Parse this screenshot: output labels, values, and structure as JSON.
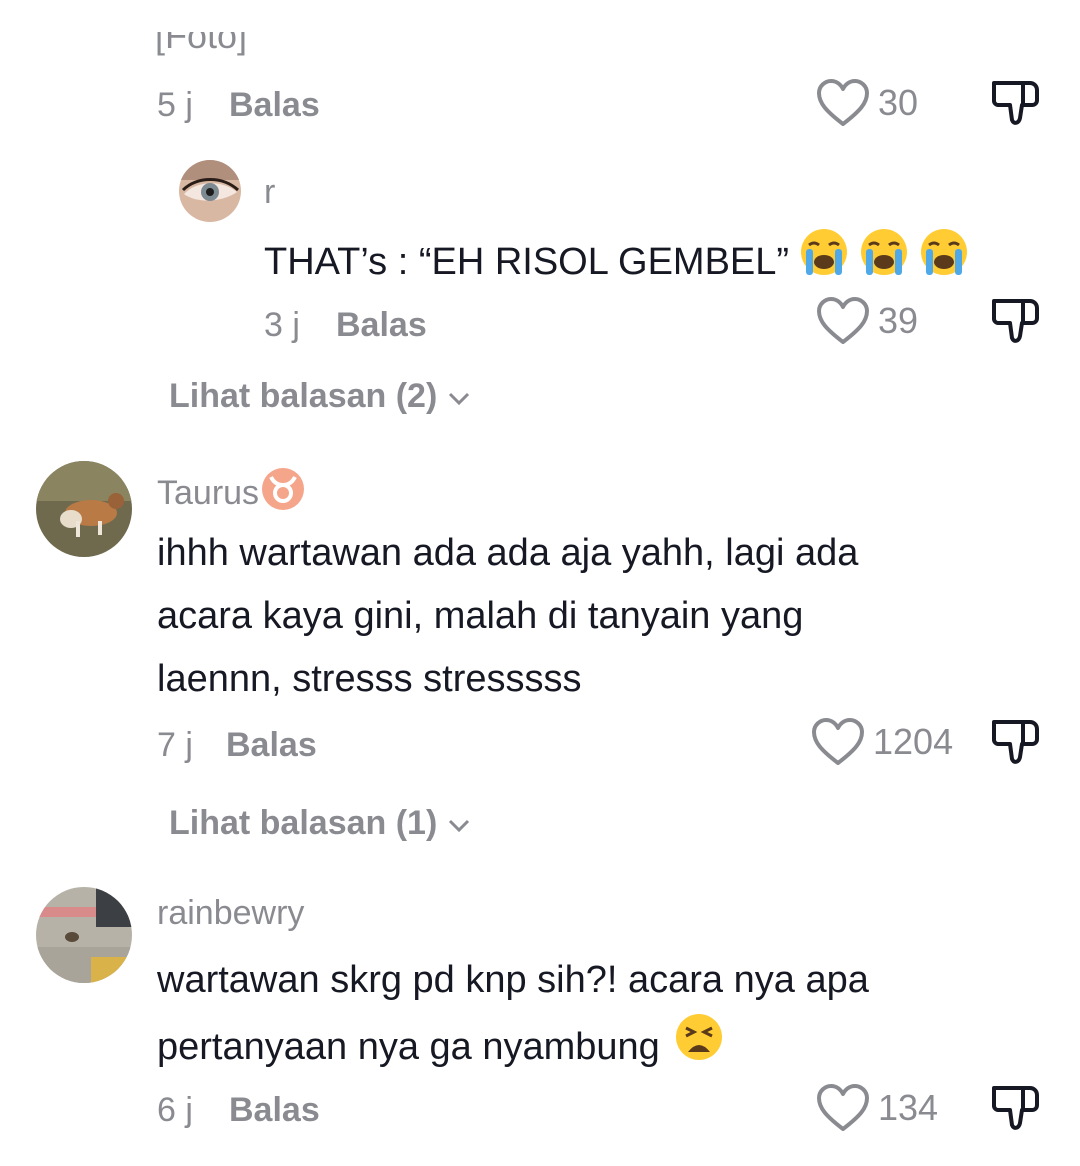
{
  "top_cutoff_text": "[Foto]",
  "comments": [
    {
      "time": "5 j",
      "reply_label": "Balas",
      "likes": "30"
    },
    {
      "username": "r",
      "text": "THAT’s : “EH RISOL GEMBEL”",
      "emoji": [
        "loudly-crying-face",
        "loudly-crying-face",
        "loudly-crying-face"
      ],
      "time": "3 j",
      "reply_label": "Balas",
      "likes": "39"
    },
    {
      "username": "Taurus",
      "username_emoji": "taurus-sign",
      "lines": [
        "ihhh wartawan ada ada aja yahh, lagi ada",
        "acara kaya gini, malah di tanyain yang",
        "laennn, stresss stresssss"
      ],
      "time": "7 j",
      "reply_label": "Balas",
      "likes": "1204"
    },
    {
      "username": "rainbewry",
      "lines": [
        "wartawan skrg pd knp sih?! acara nya apa",
        "pertanyaan nya ga nyambung"
      ],
      "emoji": [
        "weary-face"
      ],
      "time": "6 j",
      "reply_label": "Balas",
      "likes": "134"
    }
  ],
  "view_replies": [
    {
      "label": "Lihat balasan (2)"
    },
    {
      "label": "Lihat balasan (1)"
    }
  ],
  "colors": {
    "text": "#161823",
    "muted": "#8a8b91",
    "background": "#ffffff"
  }
}
